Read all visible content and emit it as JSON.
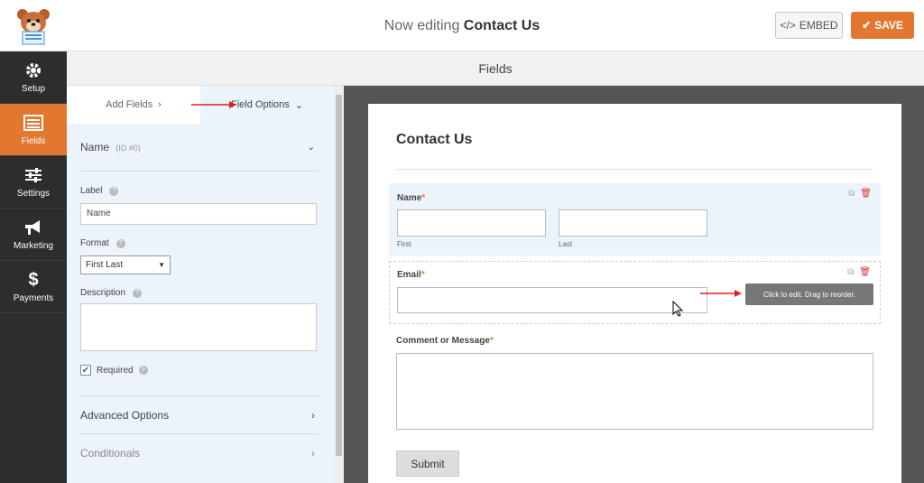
{
  "header": {
    "title_prefix": "Now editing",
    "title_form": "Contact Us",
    "embed_label": "EMBED",
    "save_label": "SAVE"
  },
  "nav": {
    "items": [
      {
        "label": "Setup",
        "icon": "gear-icon"
      },
      {
        "label": "Fields",
        "icon": "form-list-icon",
        "active": true
      },
      {
        "label": "Settings",
        "icon": "sliders-icon"
      },
      {
        "label": "Marketing",
        "icon": "megaphone-icon"
      },
      {
        "label": "Payments",
        "icon": "dollar-icon"
      }
    ]
  },
  "section_title": "Fields",
  "panel": {
    "tab_add": "Add Fields",
    "tab_options": "Field Options",
    "field_name": "Name",
    "field_id": "(ID #0)",
    "label_label": "Label",
    "label_value": "Name",
    "format_label": "Format",
    "format_value": "First Last",
    "description_label": "Description",
    "required_label": "Required",
    "advanced_label": "Advanced Options",
    "conditionals_label": "Conditionals"
  },
  "form": {
    "title": "Contact Us",
    "name_label": "Name",
    "first_label": "First",
    "last_label": "Last",
    "email_label": "Email",
    "comment_label": "Comment or Message",
    "required_mark": "*",
    "tooltip": "Click to edit. Drag to reorder.",
    "submit_label": "Submit"
  },
  "colors": {
    "accent": "#e27730",
    "nav_bg": "#2d2d2d",
    "panel_bg": "#ebf3fb"
  }
}
